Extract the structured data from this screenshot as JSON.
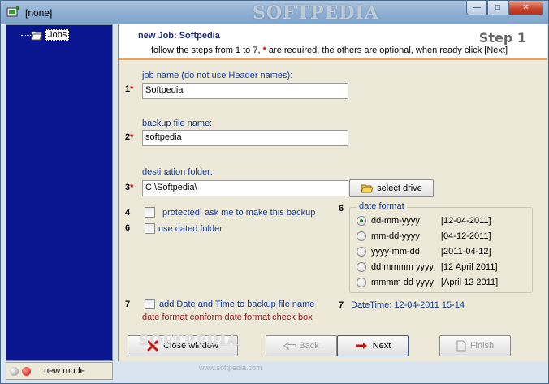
{
  "window": {
    "title": "[none]",
    "watermark": "SOFTPEDIA",
    "minimize": "—",
    "maximize": "□",
    "close": "✕"
  },
  "tree": {
    "root_label": "Jobs"
  },
  "header": {
    "title": "new Job: Softpedia",
    "subtitle_pre": "follow the steps from 1 to 7,",
    "subtitle_star": "*",
    "subtitle_post": "are required, the others are optional, when ready click [Next]",
    "step": "Step 1"
  },
  "fields": {
    "job_name": {
      "number": "1",
      "star": "*",
      "label": "job name (do not use Header names):",
      "value": "Softpedia"
    },
    "backup_file": {
      "number": "2",
      "star": "*",
      "label": "backup file name:",
      "value": "softpedia"
    },
    "dest_folder": {
      "number": "3",
      "star": "*",
      "label": "destination folder:",
      "value": "C:\\Softpedia\\",
      "button": "select drive"
    }
  },
  "options": {
    "protected": {
      "number": "4",
      "label": "protected, ask me to make this backup",
      "checked": false
    },
    "dated_folder": {
      "number": "6",
      "label": "use dated folder",
      "checked": false
    },
    "add_datetime": {
      "number": "7",
      "label": "add Date and Time to backup file name",
      "checked": false,
      "note": "date format conform date format check box"
    }
  },
  "date_format": {
    "number": "6",
    "title": "date format",
    "selected": "dd-mm-yyyy",
    "items": [
      {
        "format": "dd-mm-yyyy",
        "example": "[12-04-2011]"
      },
      {
        "format": "mm-dd-yyyy",
        "example": "[04-12-2011]"
      },
      {
        "format": "yyyy-mm-dd",
        "example": "[2011-04-12]"
      },
      {
        "format": "dd mmmm yyyy",
        "example": "[12 April 2011]"
      },
      {
        "format": "mmmm dd yyyy",
        "example": "[April 12 2011]"
      }
    ]
  },
  "datetime": {
    "number": "7",
    "text": "DateTime: 12-04-2011 15-14"
  },
  "buttons": {
    "close": "Close window",
    "back": "Back",
    "next": "Next",
    "finish": "Finish"
  },
  "status": {
    "mode": "new mode"
  },
  "watermark_bottom": "SOFTPEDIA",
  "watermark_url": "www.softpedia.com"
}
